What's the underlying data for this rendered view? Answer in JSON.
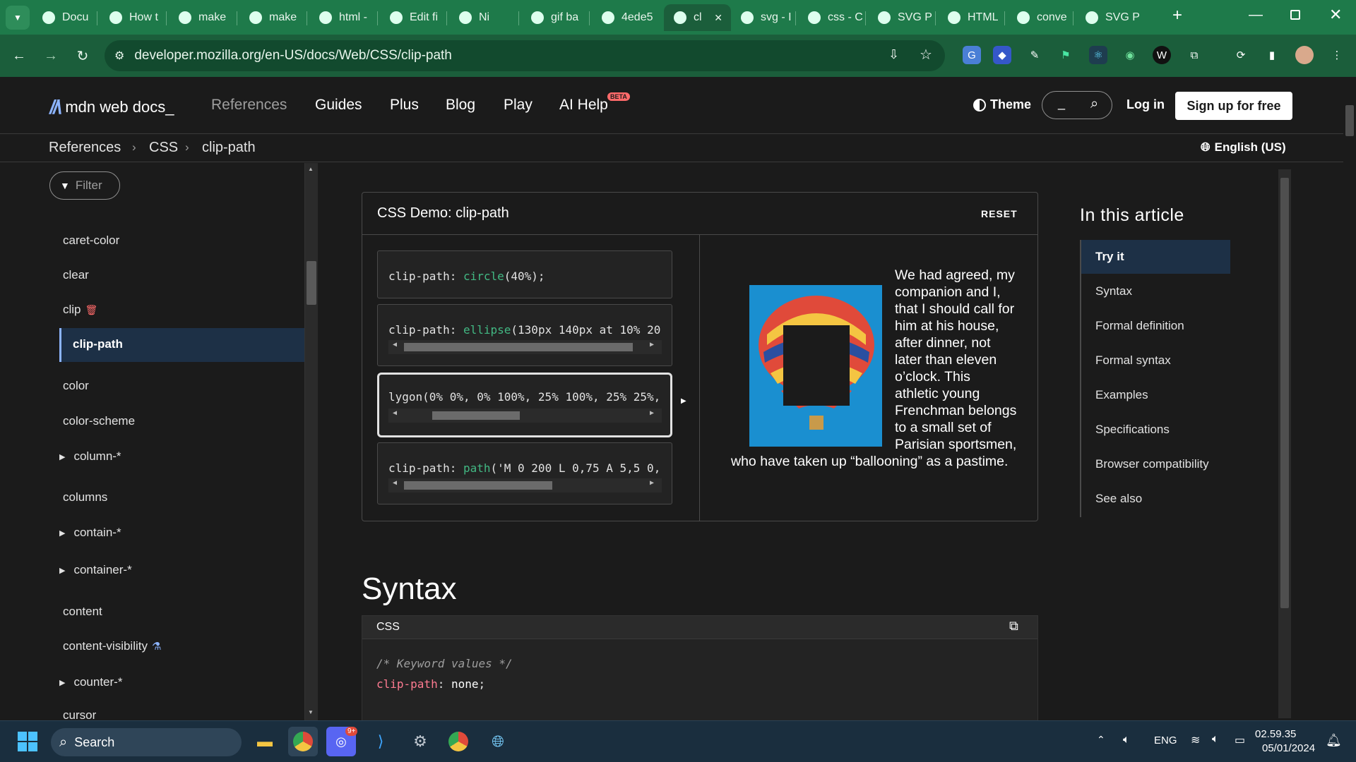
{
  "browser": {
    "tabs": [
      {
        "label": "Docu",
        "icon": "globe-icon"
      },
      {
        "label": "How t",
        "icon": "link-icon"
      },
      {
        "label": "make",
        "icon": "google-icon"
      },
      {
        "label": "make",
        "icon": "google-icon"
      },
      {
        "label": "html -",
        "icon": "stackoverflow-icon"
      },
      {
        "label": "Edit fi",
        "icon": "cloud-icon"
      },
      {
        "label": "Ni",
        "icon": "emoji-icon"
      },
      {
        "label": "gif ba",
        "icon": "google-icon"
      },
      {
        "label": "4ede5",
        "icon": "globe-icon"
      },
      {
        "label": "cl",
        "icon": "mdn-icon",
        "active": true
      },
      {
        "label": "svg - I",
        "icon": "stackoverflow-icon"
      },
      {
        "label": "css - C",
        "icon": "stackoverflow-icon"
      },
      {
        "label": "SVG P",
        "icon": "w3schools-icon"
      },
      {
        "label": "HTML",
        "icon": "w3schools-icon"
      },
      {
        "label": "conve",
        "icon": "google-icon"
      },
      {
        "label": "SVG P",
        "icon": "openai-icon"
      }
    ],
    "new_tab_label": "+",
    "url": "developer.mozilla.org/en-US/docs/Web/CSS/clip-path"
  },
  "mdn": {
    "logo_text": "mdn web docs_",
    "nav": [
      "References",
      "Guides",
      "Plus",
      "Blog",
      "Play",
      "AI Help"
    ],
    "beta_badge": "BETA",
    "theme_label": "Theme",
    "search_placeholder": "_",
    "login_label": "Log in",
    "signup_label": "Sign up for free",
    "breadcrumb": [
      "References",
      "CSS",
      "clip-path"
    ],
    "language": "English (US)"
  },
  "sidebar": {
    "filter_placeholder": "Filter",
    "items": [
      {
        "label": "caret-color"
      },
      {
        "label": "clear"
      },
      {
        "label": "clip",
        "deprecated": true
      },
      {
        "label": "clip-path",
        "active": true
      },
      {
        "label": "color"
      },
      {
        "label": "color-scheme"
      },
      {
        "label": "column-*",
        "group": true
      },
      {
        "label": "columns"
      },
      {
        "label": "contain-*",
        "group": true
      },
      {
        "label": "container-*",
        "group": true
      },
      {
        "label": "content"
      },
      {
        "label": "content-visibility",
        "experimental": true
      },
      {
        "label": "counter-*",
        "group": true
      },
      {
        "label": "cursor"
      }
    ]
  },
  "demo": {
    "title": "CSS Demo: clip-path",
    "reset_label": "RESET",
    "choices": [
      {
        "prop": "clip-path: ",
        "fn": "circle",
        "args": "(40%);"
      },
      {
        "prop": "clip-path: ",
        "fn": "ellipse",
        "args": "(130px 140px at 10% 20"
      },
      {
        "prop": "",
        "fn": "",
        "args": "lygon(0% 0%, 0% 100%, 25% 100%, 25% 25%,"
      },
      {
        "prop": "clip-path: ",
        "fn": "path",
        "args": "('M 0 200 L 0,75 A 5,5 0,"
      }
    ],
    "paragraph": "We had agreed, my companion and I, that I should call for him at his house, after dinner, not later than eleven o’clock. This athletic young Frenchman belongs to a small set of Parisian sportsmen, who have taken up “ballooning” as a pastime."
  },
  "toc": {
    "heading": "In this article",
    "items": [
      "Try it",
      "Syntax",
      "Formal definition",
      "Formal syntax",
      "Examples",
      "Specifications",
      "Browser compatibility",
      "See also"
    ]
  },
  "syntax": {
    "heading": "Syntax",
    "lang": "CSS",
    "comment": "/* Keyword values */",
    "prop": "clip-path",
    "colon": ":",
    "value": "none",
    "semicolon": ";"
  },
  "taskbar": {
    "search_label": "Search",
    "lang": "ENG",
    "time": "02.59.35",
    "date": "05/01/2024",
    "discord_badge": "9+"
  },
  "colors": {
    "chrome_green": "#1e7a4a",
    "toolbar_green": "#1b5e3b",
    "mdn_bg": "#1b1b1b",
    "active_sidebar": "#1d3046",
    "link_blue": "#8cb4ff"
  }
}
